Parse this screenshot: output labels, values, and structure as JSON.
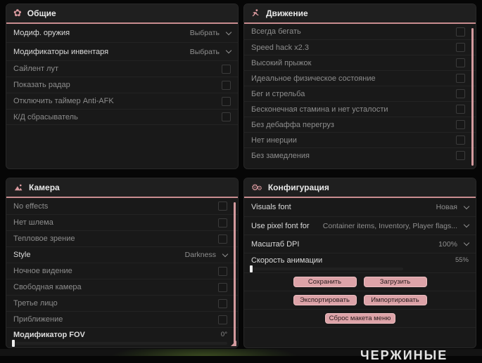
{
  "colors": {
    "accent_pink": "#d9a0a5",
    "header_underline": "#c98d90",
    "button_bg": "#dda3a8",
    "panel_bg": "#191919",
    "scrollbar": "#d49a9e"
  },
  "panels": {
    "general": {
      "title": "Общие",
      "icon": "flower-gear-icon",
      "rows": [
        {
          "label": "Модиф. оружия",
          "type": "dropdown",
          "value": "Выбрать"
        },
        {
          "label": "Модификаторы инвентаря",
          "type": "dropdown",
          "value": "Выбрать"
        },
        {
          "label": "Сайлент лут",
          "type": "checkbox",
          "checked": false
        },
        {
          "label": "Показать радар",
          "type": "checkbox",
          "checked": false
        },
        {
          "label": "Отключить таймер Anti-AFK",
          "type": "checkbox",
          "checked": false
        },
        {
          "label": "К/Д сбрасыватель",
          "type": "checkbox",
          "checked": false
        }
      ]
    },
    "movement": {
      "title": "Движение",
      "icon": "runner-icon",
      "rows": [
        {
          "label": "Всегда бегать",
          "type": "checkbox",
          "checked": false
        },
        {
          "label": "Speed hack x2.3",
          "type": "checkbox",
          "checked": false
        },
        {
          "label": "Высокий прыжок",
          "type": "checkbox",
          "checked": false
        },
        {
          "label": "Идеальное физическое состояние",
          "type": "checkbox",
          "checked": false
        },
        {
          "label": "Бег и стрельба",
          "type": "checkbox",
          "checked": false
        },
        {
          "label": "Бесконечная стамина и нет усталости",
          "type": "checkbox",
          "checked": false
        },
        {
          "label": "Без дебаффа перегруз",
          "type": "checkbox",
          "checked": false
        },
        {
          "label": "Нет инерции",
          "type": "checkbox",
          "checked": false
        },
        {
          "label": "Без замедления",
          "type": "checkbox",
          "checked": false
        }
      ]
    },
    "camera": {
      "title": "Камера",
      "icon": "image-icon",
      "rows": [
        {
          "label": "No effects",
          "type": "checkbox",
          "checked": false
        },
        {
          "label": "Нет шлема",
          "type": "checkbox",
          "checked": false
        },
        {
          "label": "Тепловое зрение",
          "type": "checkbox",
          "checked": false
        },
        {
          "label": "Style",
          "type": "dropdown",
          "value": "Darkness"
        },
        {
          "label": "Ночное видение",
          "type": "checkbox",
          "checked": false
        },
        {
          "label": "Свободная камера",
          "type": "checkbox",
          "checked": false
        },
        {
          "label": "Третье лицо",
          "type": "checkbox",
          "checked": false
        },
        {
          "label": "Приближение",
          "type": "checkbox",
          "checked": false
        },
        {
          "label": "Модификатор FOV",
          "type": "slider",
          "value": "0°",
          "fill": "1%"
        }
      ]
    },
    "config": {
      "title": "Конфигурация",
      "icon": "gears-icon",
      "rows": [
        {
          "label": "Visuals font",
          "type": "dropdown",
          "value": "Новая"
        },
        {
          "label": "Use pixel font for",
          "type": "dropdown",
          "value": "Container items, Inventory, Player flags..."
        },
        {
          "label": "Масштаб DPI",
          "type": "dropdown",
          "value": "100%"
        },
        {
          "label": "Скорость анимации",
          "type": "slider",
          "value": "55%",
          "fill": "55%"
        }
      ],
      "buttons": {
        "save": "Сохранить",
        "load": "Загрузить",
        "export": "Экспортировать",
        "import": "Импортировать",
        "reset_layout": "Сброс макета меню"
      }
    }
  },
  "background": {
    "watermark_text": "ЧЕРЖИНЫЕ"
  }
}
